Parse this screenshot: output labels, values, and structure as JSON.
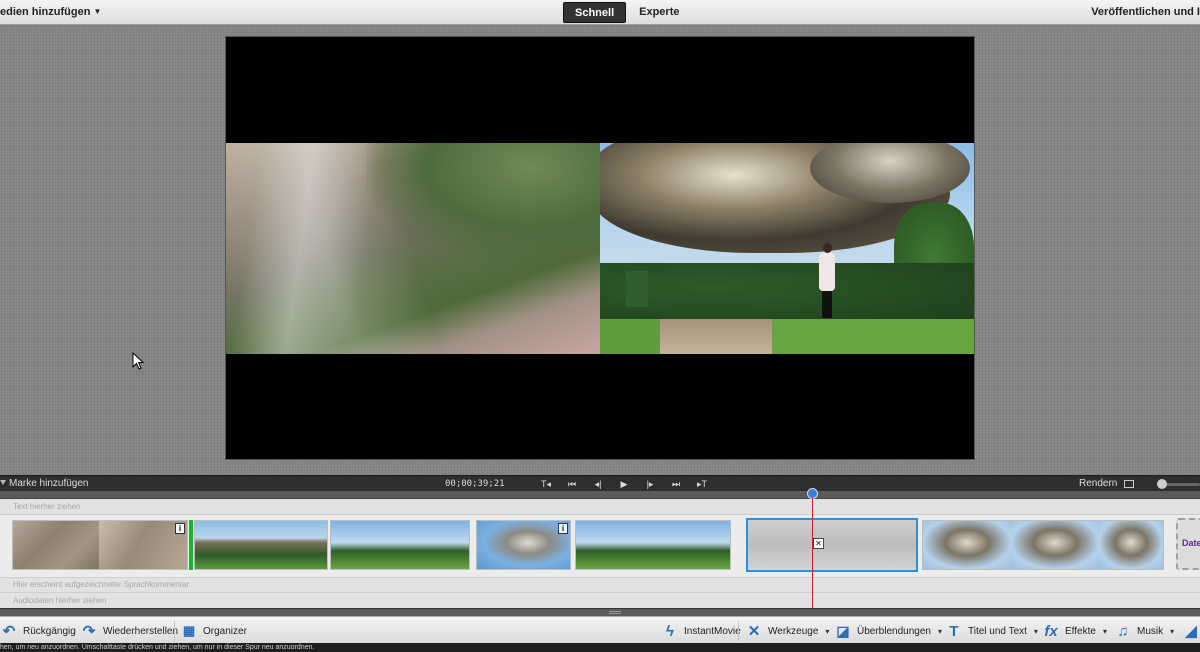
{
  "topbar": {
    "add_media": "edien hinzufügen",
    "modes": [
      "Schnell",
      "Experte"
    ],
    "publish": "Veröffentlichen und I"
  },
  "timeline_bar": {
    "marker_add": "Marke hinzufügen",
    "timecode": "00;00;39;21",
    "transport": [
      "T◂",
      "⏮",
      "◂|",
      "▶",
      "|▸",
      "⏭",
      "▸T"
    ],
    "render": "Rendern"
  },
  "tracks": {
    "text_hint": "Text hierher ziehen",
    "voice_hint": "Hier erscheint aufgezeichneter Sprachkommentar",
    "audio_hint": "Audiodaten hierher ziehen",
    "file_clip_label": "Datei"
  },
  "bottombar": {
    "undo": "Rückgängig",
    "redo": "Wiederherstellen",
    "organizer": "Organizer",
    "instantmovie": "InstantMovie",
    "tools": "Werkzeuge",
    "transitions": "Überblendungen",
    "titles": "Titel und Text",
    "effects": "Effekte",
    "music": "Musik"
  },
  "status": "hen, um neu anzuordnen. Umschalttaste drücken und ziehen, um nur in dieser Spur neu anzuordnen.",
  "colors": {
    "selection": "#2b8fe0",
    "playhead": "#d82020",
    "accent_blue": "#2c6db8"
  }
}
